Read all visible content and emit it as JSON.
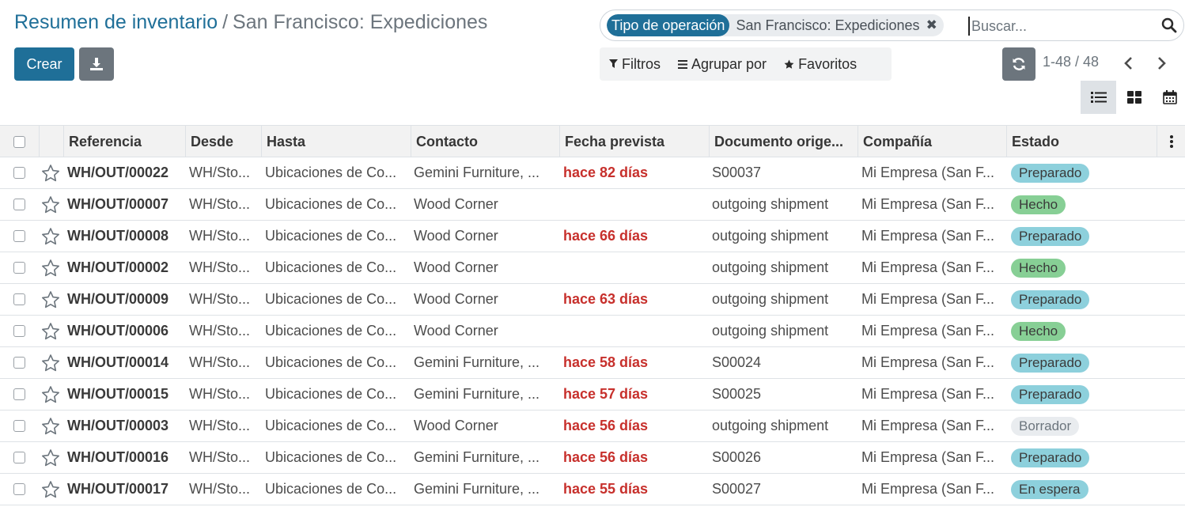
{
  "breadcrumb": {
    "parent": "Resumen de inventario",
    "separator": "/",
    "current": "San Francisco: Expediciones"
  },
  "actions": {
    "create_label": "Crear",
    "download_icon": "download-icon"
  },
  "search": {
    "facet_label": "Tipo de operación",
    "facet_value": "San Francisco: Expediciones",
    "facet_remove": "✖",
    "placeholder": "Buscar..."
  },
  "filters": {
    "filters_label": "Filtros",
    "group_by_label": "Agrupar por",
    "favorites_label": "Favoritos"
  },
  "pager": {
    "value": "1-48 / 48"
  },
  "table": {
    "headers": {
      "reference": "Referencia",
      "from": "Desde",
      "to": "Hasta",
      "contact": "Contacto",
      "scheduled": "Fecha prevista",
      "source": "Documento orige...",
      "company": "Compañía",
      "status": "Estado"
    },
    "rows": [
      {
        "reference": "WH/OUT/00022",
        "from": "WH/Sto...",
        "to": "Ubicaciones de Co...",
        "contact": "Gemini Furniture, ...",
        "scheduled": "hace 82 días",
        "source": "S00037",
        "company": "Mi Empresa (San F...",
        "status": "Preparado",
        "status_kind": "prep"
      },
      {
        "reference": "WH/OUT/00007",
        "from": "WH/Sto...",
        "to": "Ubicaciones de Co...",
        "contact": "Wood Corner",
        "scheduled": "",
        "source": "outgoing shipment",
        "company": "Mi Empresa (San F...",
        "status": "Hecho",
        "status_kind": "done"
      },
      {
        "reference": "WH/OUT/00008",
        "from": "WH/Sto...",
        "to": "Ubicaciones de Co...",
        "contact": "Wood Corner",
        "scheduled": "hace 66 días",
        "source": "outgoing shipment",
        "company": "Mi Empresa (San F...",
        "status": "Preparado",
        "status_kind": "prep"
      },
      {
        "reference": "WH/OUT/00002",
        "from": "WH/Sto...",
        "to": "Ubicaciones de Co...",
        "contact": "Wood Corner",
        "scheduled": "",
        "source": "outgoing shipment",
        "company": "Mi Empresa (San F...",
        "status": "Hecho",
        "status_kind": "done"
      },
      {
        "reference": "WH/OUT/00009",
        "from": "WH/Sto...",
        "to": "Ubicaciones de Co...",
        "contact": "Wood Corner",
        "scheduled": "hace 63 días",
        "source": "outgoing shipment",
        "company": "Mi Empresa (San F...",
        "status": "Preparado",
        "status_kind": "prep"
      },
      {
        "reference": "WH/OUT/00006",
        "from": "WH/Sto...",
        "to": "Ubicaciones de Co...",
        "contact": "Wood Corner",
        "scheduled": "",
        "source": "outgoing shipment",
        "company": "Mi Empresa (San F...",
        "status": "Hecho",
        "status_kind": "done"
      },
      {
        "reference": "WH/OUT/00014",
        "from": "WH/Sto...",
        "to": "Ubicaciones de Co...",
        "contact": "Gemini Furniture, ...",
        "scheduled": "hace 58 días",
        "source": "S00024",
        "company": "Mi Empresa (San F...",
        "status": "Preparado",
        "status_kind": "prep"
      },
      {
        "reference": "WH/OUT/00015",
        "from": "WH/Sto...",
        "to": "Ubicaciones de Co...",
        "contact": "Gemini Furniture, ...",
        "scheduled": "hace 57 días",
        "source": "S00025",
        "company": "Mi Empresa (San F...",
        "status": "Preparado",
        "status_kind": "prep"
      },
      {
        "reference": "WH/OUT/00003",
        "from": "WH/Sto...",
        "to": "Ubicaciones de Co...",
        "contact": "Wood Corner",
        "scheduled": "hace 56 días",
        "source": "outgoing shipment",
        "company": "Mi Empresa (San F...",
        "status": "Borrador",
        "status_kind": "draft"
      },
      {
        "reference": "WH/OUT/00016",
        "from": "WH/Sto...",
        "to": "Ubicaciones de Co...",
        "contact": "Gemini Furniture, ...",
        "scheduled": "hace 56 días",
        "source": "S00026",
        "company": "Mi Empresa (San F...",
        "status": "Preparado",
        "status_kind": "prep"
      },
      {
        "reference": "WH/OUT/00017",
        "from": "WH/Sto...",
        "to": "Ubicaciones de Co...",
        "contact": "Gemini Furniture, ...",
        "scheduled": "hace 55 días",
        "source": "S00027",
        "company": "Mi Empresa (San F...",
        "status": "En espera",
        "status_kind": "wait"
      }
    ]
  },
  "colors": {
    "primary": "#1f6f98",
    "secondary": "#6c757d",
    "late_date": "#c7302c",
    "badge_ready": "#8dd0dc",
    "badge_done": "#87cf95",
    "badge_draft": "#e9ecef"
  }
}
